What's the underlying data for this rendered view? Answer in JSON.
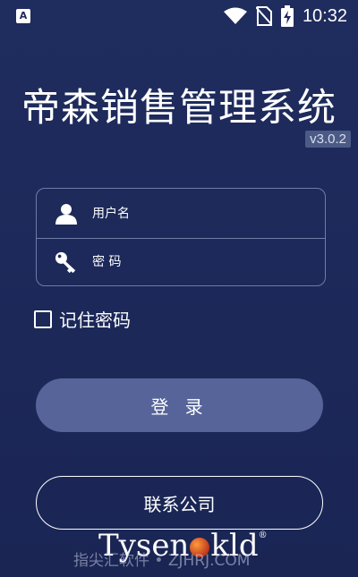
{
  "status_bar": {
    "app_icon_letter": "A",
    "time": "10:32"
  },
  "header": {
    "title": "帝森销售管理系统",
    "version": "v3.0.2"
  },
  "login_form": {
    "username_placeholder": "用户名",
    "password_placeholder": "密 码",
    "remember_label": "记住密码",
    "remember_checked": false
  },
  "actions": {
    "login_label": "登 录",
    "contact_label": "联系公司"
  },
  "footer": {
    "brand_left": "Tysen",
    "brand_right": "kld",
    "brand_reg": "®",
    "watermark": "指尖汇软件 • ZJHRJ.COM"
  },
  "colors": {
    "background": "#1e2a5c",
    "login_button": "#56649a",
    "field_border": "#6f7ca8"
  }
}
